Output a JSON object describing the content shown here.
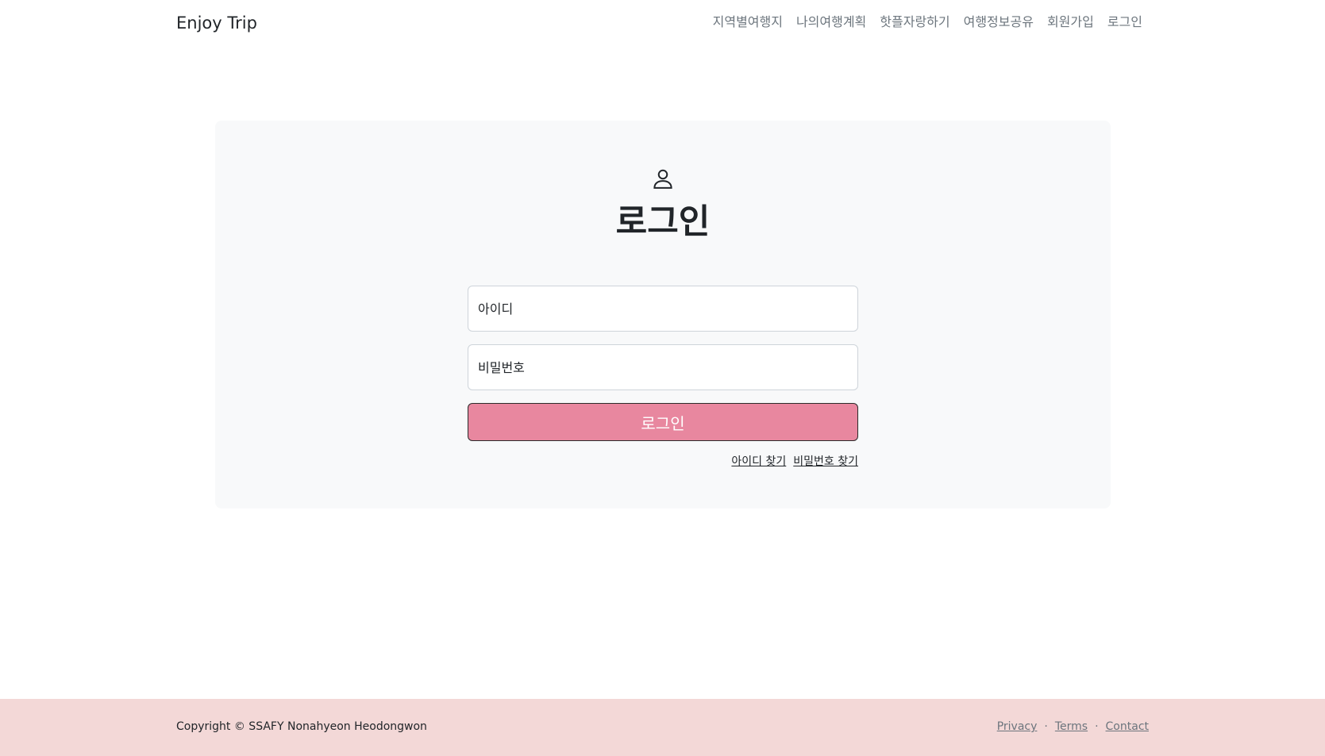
{
  "navbar": {
    "brand": "Enjoy Trip",
    "links": [
      "지역별여행지",
      "나의여행계획",
      "핫플자랑하기",
      "여행정보공유",
      "회원가입",
      "로그인"
    ]
  },
  "login": {
    "icon": "user-icon",
    "title": "로그인",
    "id_placeholder": "아이디",
    "pw_placeholder": "비밀번호",
    "submit_label": "로그인",
    "find_id": "아이디 찾기",
    "find_pw": "비밀번호 찾기",
    "button_color": "#e8879f"
  },
  "footer": {
    "copyright": "Copyright © SSAFY Nonahyeon Heodongwon",
    "links": [
      "Privacy",
      "Terms",
      "Contact"
    ],
    "separator": "·",
    "background": "#f3d8d7"
  }
}
